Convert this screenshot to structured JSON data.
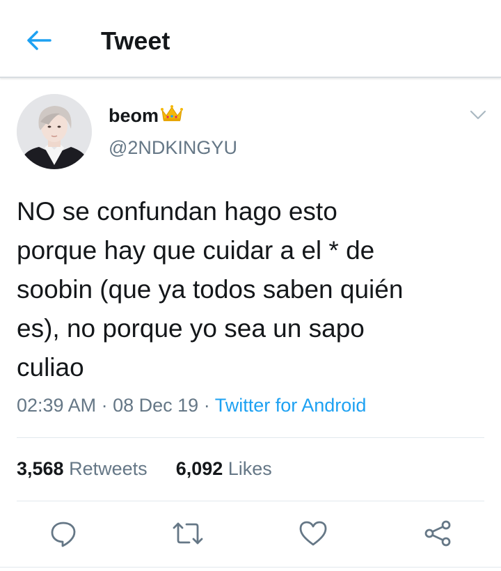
{
  "header": {
    "title": "Tweet",
    "back_icon": "back-arrow-icon"
  },
  "colors": {
    "accent": "#1da1f2",
    "text": "#14171a",
    "muted": "#657786",
    "divider": "#e1e8ed",
    "crown": "#f5b80a"
  },
  "tweet": {
    "display_name": "beom",
    "badge_icon": "crown-emoji-icon",
    "handle": "@2NDKINGYU",
    "text_lines": [
      "NO se confundan hago esto",
      "porque hay que cuidar a el * de",
      "soobin (que ya todos saben quién",
      "es), no porque yo sea un sapo",
      "culiao"
    ],
    "time": "02:39 AM",
    "sep": "·",
    "date": "08 Dec 19",
    "source": "Twitter for Android"
  },
  "stats": {
    "retweets_count": "3,568",
    "retweets_label": "Retweets",
    "likes_count": "6,092",
    "likes_label": "Likes"
  },
  "actions": [
    "reply-icon",
    "retweet-icon",
    "like-icon",
    "share-icon"
  ]
}
